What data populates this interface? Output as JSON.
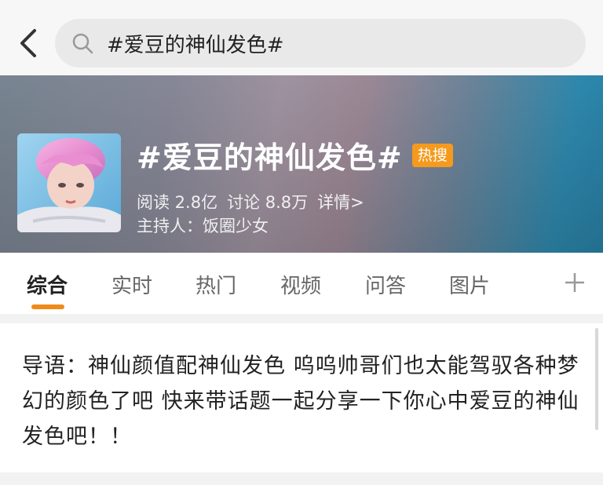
{
  "nav": {
    "search_value": "#爱豆的神仙发色#"
  },
  "header": {
    "title": "#爱豆的神仙发色#",
    "badge": "热搜",
    "reads": "阅读 2.8亿",
    "discussions": "讨论 8.8万",
    "details": "详情>",
    "host": "主持人：饭圈少女"
  },
  "tabs": [
    {
      "label": "综合",
      "active": true
    },
    {
      "label": "实时"
    },
    {
      "label": "热门"
    },
    {
      "label": "视频"
    },
    {
      "label": "问答"
    },
    {
      "label": "图片"
    }
  ],
  "intro": {
    "text": "导语：神仙颜值配神仙发色 呜呜帅哥们也太能驾驭各种梦幻的颜色了吧 快来带话题一起分享一下你心中爱豆的神仙发色吧！！"
  },
  "colors": {
    "accent": "#f08a1a",
    "badge": "#f59a1d"
  },
  "icons": [
    "back-arrow-icon",
    "search-icon",
    "plus-icon"
  ]
}
